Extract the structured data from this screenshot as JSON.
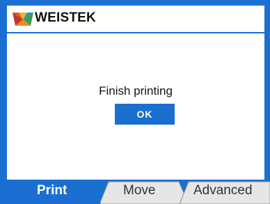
{
  "header": {
    "brand": "WEISTEK",
    "logo_icon": "weistek-logo-icon"
  },
  "dialog": {
    "message": "Finish printing",
    "ok_label": "OK"
  },
  "tabs": [
    {
      "label": "Print",
      "active": true
    },
    {
      "label": "Move",
      "active": false
    },
    {
      "label": "Advanced",
      "active": false
    }
  ],
  "colors": {
    "accent": "#1a6fd1",
    "tab_inactive": "#e6e6e6",
    "text": "#111111"
  }
}
